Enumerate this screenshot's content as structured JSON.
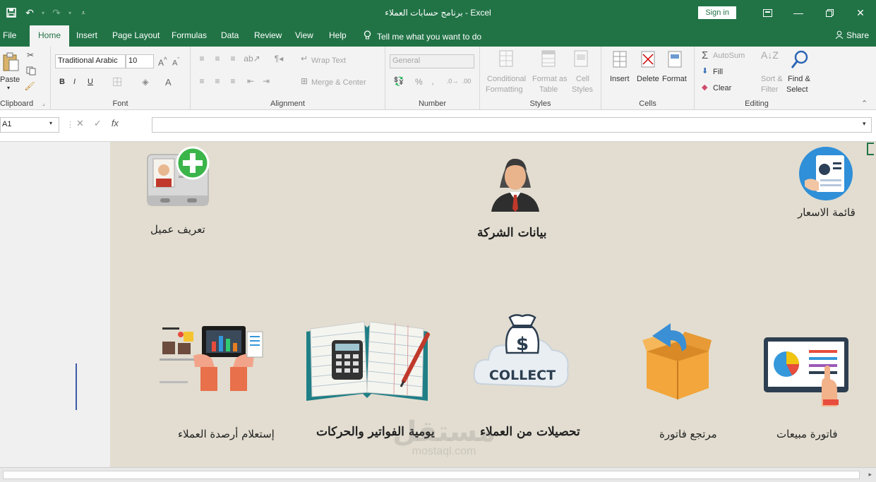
{
  "window": {
    "title": "برنامج حسابات العملاء  -  Excel",
    "sign_in": "Sign in"
  },
  "menu": {
    "tabs": [
      "File",
      "Home",
      "Insert",
      "Page Layout",
      "Formulas",
      "Data",
      "Review",
      "View",
      "Help"
    ],
    "tell_me": "Tell me what you want to do",
    "share": "Share"
  },
  "ribbon": {
    "clipboard": {
      "paste": "Paste",
      "label": "Clipboard"
    },
    "font": {
      "name": "Traditional Arabic",
      "size": "10",
      "label": "Font",
      "bold": "B",
      "italic": "I",
      "underline": "U"
    },
    "alignment": {
      "wrap_text": "Wrap Text",
      "merge_center": "Merge & Center",
      "label": "Alignment"
    },
    "number": {
      "format": "General",
      "percent": "%",
      "label": "Number"
    },
    "styles": {
      "conditional": "Conditional",
      "formatting": "Formatting",
      "format_as": "Format as",
      "table": "Table",
      "cell": "Cell",
      "cell_styles": "Styles",
      "label": "Styles"
    },
    "cells": {
      "insert": "Insert",
      "delete": "Delete",
      "format": "Format",
      "label": "Cells"
    },
    "editing": {
      "autosum": "AutoSum",
      "fill": "Fill",
      "clear": "Clear",
      "sort": "Sort &",
      "filter": "Filter",
      "find": "Find &",
      "select": "Select",
      "label": "Editing"
    }
  },
  "formula_bar": {
    "name_box": "A1",
    "fx": "fx"
  },
  "sheet": {
    "tiles": {
      "define_client": "تعريف عميل",
      "company_data": "بيانات الشركة",
      "price_list": "قائمة الاسعار",
      "client_balances": "إستعلام أرصدة العملاء",
      "daily_invoices": "يومية الفواتير والحركات",
      "collections": "تحصيلات من العملاء",
      "invoice_return": "مرتجع فاتورة",
      "sales_invoice": "فاتورة مبيعات"
    },
    "collect_text": "COLLECT",
    "dollar": "$"
  },
  "watermark": {
    "ar": "مستقل",
    "en": "mostaql.com"
  },
  "colors": {
    "excel_green": "#217346",
    "canvas_bg": "#e2ddd0",
    "side_pane": "#f0f0f0"
  }
}
